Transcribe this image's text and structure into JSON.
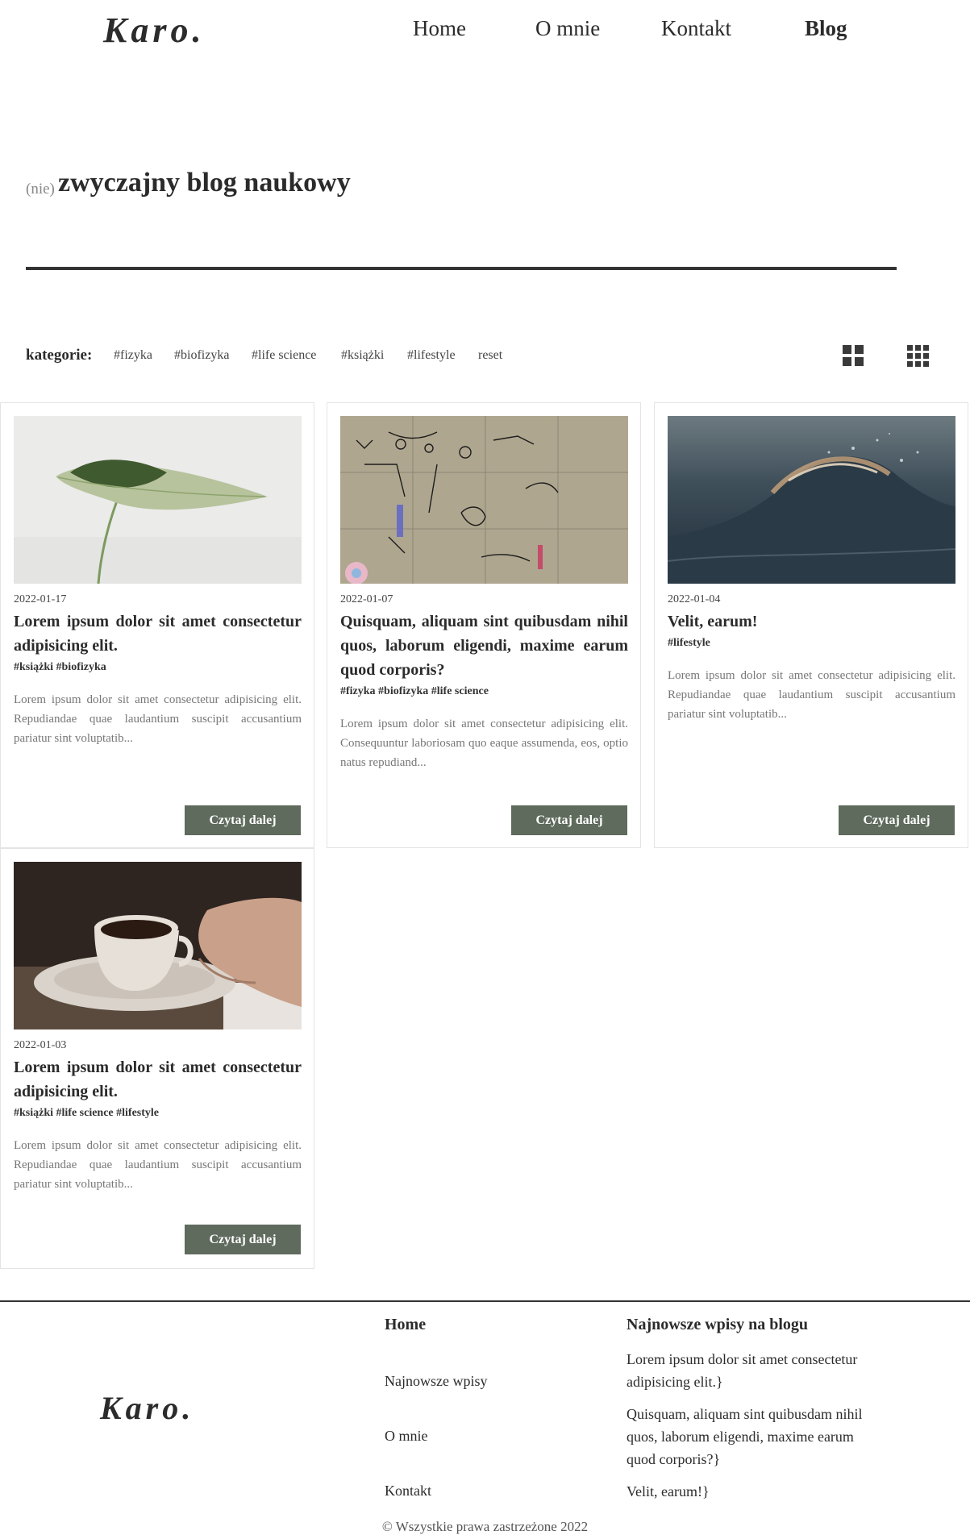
{
  "header": {
    "logo": "Karo.",
    "nav": [
      "Home",
      "O mnie",
      "Kontakt",
      "Blog"
    ]
  },
  "hero": {
    "prefix": "(nie)",
    "title": "zwyczajny blog naukowy"
  },
  "filters": {
    "label": "kategorie:",
    "tags": [
      "#fizyka",
      "#biofizyka",
      "#life science",
      "#książki",
      "#lifestyle",
      "reset"
    ]
  },
  "posts": [
    {
      "date": "2022-01-17",
      "title": "Lorem ipsum dolor sit amet consectetur adipisicing elit.",
      "tags": "#książki #biofizyka",
      "excerpt": "Lorem ipsum dolor sit amet consectetur adipisicing elit. Repudiandae quae laudantium suscipit accusantium pariatur sint voluptatib...",
      "button": "Czytaj dalej",
      "image": "leaf"
    },
    {
      "date": "2022-01-07",
      "title": "Quisquam, aliquam sint quibusdam nihil quos, laborum eligendi, maxime earum quod corporis?",
      "tags": "#fizyka #biofizyka #life science",
      "excerpt": "Lorem ipsum dolor sit amet consectetur adipisicing elit. Consequuntur laboriosam quo eaque assumenda, eos, optio natus repudiand...",
      "button": "Czytaj dalej",
      "image": "lab-whiteboard"
    },
    {
      "date": "2022-01-04",
      "title": "Velit, earum!",
      "tags": "#lifestyle",
      "excerpt": "Lorem ipsum dolor sit amet consectetur adipisicing elit. Repudiandae quae laudantium suscipit accusantium pariatur sint voluptatib...",
      "button": "Czytaj dalej",
      "image": "wave"
    },
    {
      "date": "2022-01-03",
      "title": "Lorem ipsum dolor sit amet consectetur adipisicing elit.",
      "tags": "#książki #life science #lifestyle",
      "excerpt": "Lorem ipsum dolor sit amet consectetur adipisicing elit. Repudiandae quae laudantium suscipit accusantium pariatur sint voluptatib...",
      "button": "Czytaj dalej",
      "image": "coffee"
    }
  ],
  "footer": {
    "logo": "Karo.",
    "links": [
      "Home",
      "Najnowsze wpisy",
      "O mnie",
      "Kontakt"
    ],
    "recent_heading": "Najnowsze wpisy na blogu",
    "recent": [
      "Lorem ipsum dolor sit amet consectetur adipisicing elit.}",
      "Quisquam, aliquam sint quibusdam nihil quos, laborum eligendi, maxime earum quod corporis?}",
      "Velit, earum!}"
    ],
    "copyright": "© Wszystkie prawa zastrzeżone 2022"
  },
  "colors": {
    "button_bg": "#5f6b5d",
    "text": "#2b2b2b",
    "rule": "#333333"
  }
}
